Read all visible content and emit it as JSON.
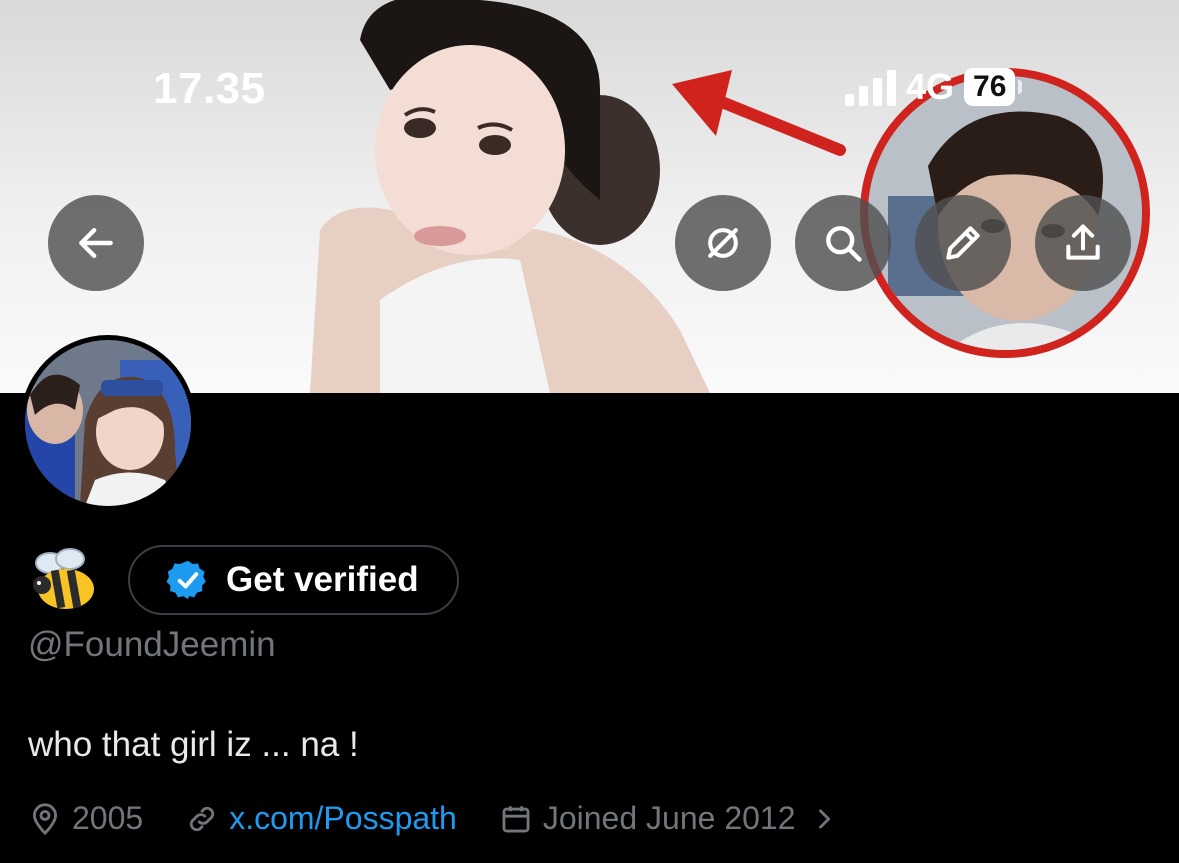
{
  "status_bar": {
    "time": "17.35",
    "network": "4G",
    "battery": "76"
  },
  "header": {
    "back_icon": "arrow-left-icon",
    "actions": [
      "grok-icon",
      "search-icon",
      "edit-icon",
      "share-icon"
    ]
  },
  "profile": {
    "emoji_name": "bee-emoji",
    "verify_label": "Get verified",
    "handle": "@FoundJeemin",
    "bio": "who that girl iz ... na !",
    "location": "2005",
    "website": "x.com/Posspath",
    "joined": "Joined June 2012"
  },
  "colors": {
    "accent": "#1d9bf0",
    "muted": "#71767b",
    "annotation_red": "#d0231e"
  }
}
